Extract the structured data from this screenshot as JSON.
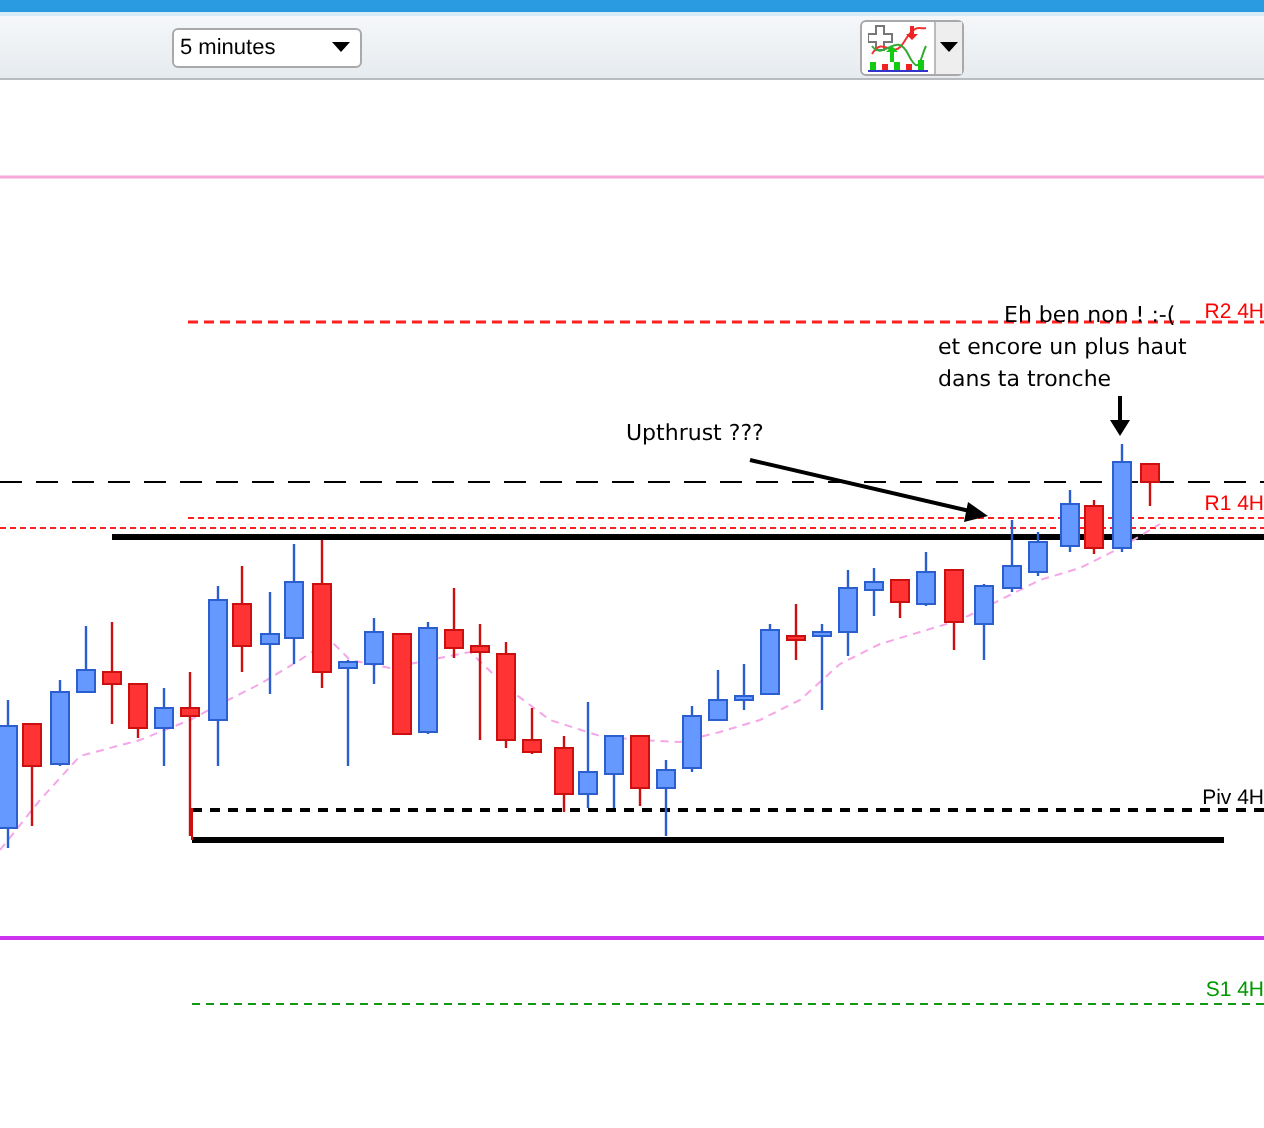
{
  "toolbar": {
    "timeframe": {
      "value": "5 minutes"
    }
  },
  "chart": {
    "level_labels": [
      {
        "label": "R2 4H",
        "color": "#ff0000"
      },
      {
        "label": "R1 4H",
        "color": "#ff0000"
      },
      {
        "label": "Piv 4H",
        "color": "#000000"
      },
      {
        "label": "S1 4H",
        "color": "#009900"
      }
    ],
    "annotations": [
      {
        "lines": [
          "Eh ben non ! :-(",
          "et encore un plus haut",
          "dans ta tronche"
        ]
      },
      {
        "lines": [
          "Upthrust ???"
        ]
      }
    ]
  }
}
